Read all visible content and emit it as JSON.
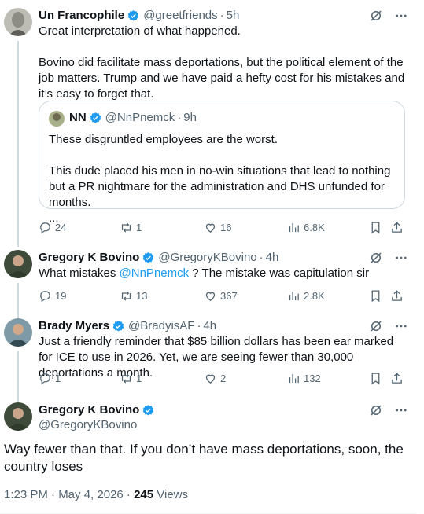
{
  "posts": [
    {
      "name": "Un Francophile",
      "handle": "@greetfriends",
      "time": "5h",
      "text": "Great interpretation of what happened.\n\nBovino did facilitate mass deportations, but the political element of the job matters. Trump and we have paid a hefty cost for his mistakes and it’s easy to forget that.",
      "quote": {
        "name": "NN",
        "handle": "@NnPnemck",
        "time": "9h",
        "text": "These disgruntled employees are the worst.\n\nThis dude placed his men in no-win situations that lead to nothing but a PR nightmare for the administration and DHS unfunded for months.\n..."
      },
      "replies": "24",
      "reposts": "1",
      "likes": "16",
      "views": "6.8K"
    },
    {
      "name": "Gregory K Bovino",
      "handle": "@GregoryKBovino",
      "time": "4h",
      "text_before": "What mistakes ",
      "mention": "@NnPnemck",
      "text_after": " ?  The mistake was capitulation sir",
      "replies": "19",
      "reposts": "13",
      "likes": "367",
      "views": "2.8K"
    },
    {
      "name": "Brady Myers",
      "handle": "@BradyisAF",
      "time": "4h",
      "text": "Just a friendly reminder that $85 billion dollars has been ear marked for ICE to use in 2026. Yet, we are seeing fewer than 30,000 deportations a month.",
      "replies": "1",
      "reposts": "1",
      "likes": "2",
      "views": "132"
    }
  ],
  "main": {
    "name": "Gregory K Bovino",
    "handle": "@GregoryKBovino",
    "text": "Way fewer than that.  If you don’t have mass deportations, soon, the country loses",
    "timestamp": "1:23 PM · May 4, 2026 · ",
    "views_count": "245",
    "views_label": " Views"
  },
  "separator": "·",
  "colors": {
    "accent": "#1d9bf0",
    "muted": "#536471",
    "border": "#cfd9de"
  }
}
